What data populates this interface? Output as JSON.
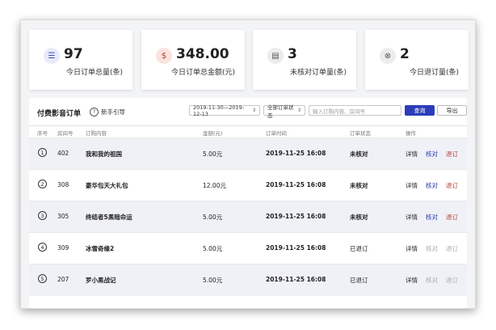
{
  "stats": [
    {
      "icon": "list-icon",
      "value": "97",
      "label": "今日订单总量(条)",
      "icon_color": "#3a4bb8",
      "icon_bg": "#e8ebf8",
      "glyph": "☰"
    },
    {
      "icon": "dollar-coin-icon",
      "value": "348.00",
      "label": "今日订单总金额(元)",
      "icon_color": "#c0392b",
      "icon_bg": "#fae3df",
      "glyph": "$"
    },
    {
      "icon": "document-check-icon",
      "value": "3",
      "label": "未核对订单量(条)",
      "icon_color": "#555555",
      "icon_bg": "#ececec",
      "glyph": "▤"
    },
    {
      "icon": "close-circle-icon",
      "value": "2",
      "label": "今日退订量(条)",
      "icon_color": "#555555",
      "icon_bg": "#ececec",
      "glyph": "⊗"
    }
  ],
  "panel": {
    "title": "付费影音订单",
    "guide_label": "新手引导",
    "guide_glyph": "?",
    "date_range": "2019-11-30—2019-12-13",
    "status_select": "全部订单状态",
    "search_placeholder": "输入订购内容、房间号",
    "search_button": "查询",
    "export_button": "导出",
    "dropdown_glyph": "⇕"
  },
  "columns": {
    "index": "序号",
    "room": "房间号",
    "content": "订购内容",
    "amount": "金额(元)",
    "time": "订单时间",
    "status": "订单状态",
    "action": "操作"
  },
  "rows": [
    {
      "index": "1",
      "room": "402",
      "content": "我和我的祖国",
      "amount": "5.00元",
      "time": "2019-11-25 16:08",
      "status": "未核对",
      "state": "unverified",
      "detail": "详情",
      "verify": "核对",
      "refund": "退订"
    },
    {
      "index": "2",
      "room": "308",
      "content": "豪华包天大礼包",
      "amount": "12.00元",
      "time": "2019-11-25 16:08",
      "status": "未核对",
      "state": "unverified",
      "detail": "详情",
      "verify": "核对",
      "refund": "退订"
    },
    {
      "index": "3",
      "room": "305",
      "content": "终结者5黑暗命运",
      "amount": "5.00元",
      "time": "2019-11-25 16:08",
      "status": "未核对",
      "state": "unverified",
      "detail": "详情",
      "verify": "核对",
      "refund": "退订"
    },
    {
      "index": "4",
      "room": "309",
      "content": "冰雪奇缘2",
      "amount": "5.00元",
      "time": "2019-11-25 16:08",
      "status": "已退订",
      "state": "refunded",
      "detail": "详情",
      "verify": "核对",
      "refund": "退订"
    },
    {
      "index": "5",
      "room": "207",
      "content": "罗小黑战记",
      "amount": "5.00元",
      "time": "2019-11-25 16:08",
      "status": "已退订",
      "state": "refunded",
      "detail": "详情",
      "verify": "核对",
      "refund": "退订"
    }
  ]
}
